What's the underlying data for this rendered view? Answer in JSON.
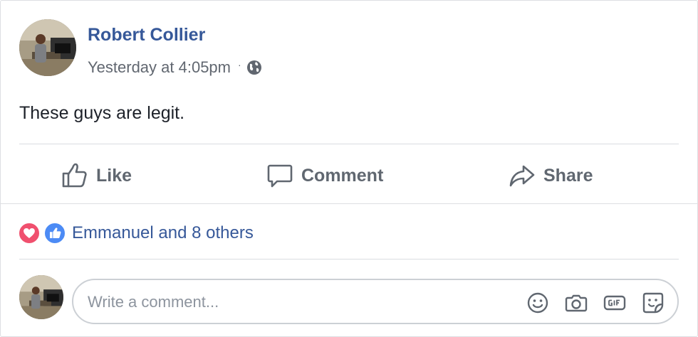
{
  "post": {
    "author": "Robert Collier",
    "timestamp": "Yesterday at 4:05pm",
    "separator": "·",
    "privacy_icon": "globe-icon",
    "text": "These guys are legit."
  },
  "actions": {
    "like_label": "Like",
    "comment_label": "Comment",
    "share_label": "Share"
  },
  "reactions": {
    "icons": [
      "love-reaction-icon",
      "like-reaction-icon"
    ],
    "summary": "Emmanuel and 8 others"
  },
  "composer": {
    "placeholder": "Write a comment...",
    "icons": [
      "emoji-icon",
      "camera-icon",
      "gif-icon",
      "sticker-icon"
    ]
  },
  "colors": {
    "link_blue": "#365899",
    "secondary_text": "#616770",
    "action_grey": "#606770",
    "love_red": "#f0506e",
    "like_blue": "#4c8bf5"
  }
}
